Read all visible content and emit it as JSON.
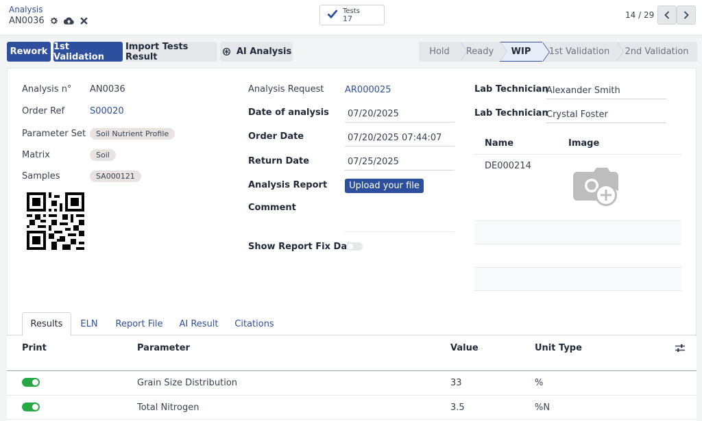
{
  "breadcrumb": {
    "parent": "Analysis",
    "record": "AN0036"
  },
  "smart_button": {
    "label": "Tests",
    "value": "17"
  },
  "pager": {
    "value": "14 / 29"
  },
  "actions": {
    "rework": "Rework",
    "validation": "1st Validation",
    "import": "Import Tests Result",
    "ai": "AI Analysis"
  },
  "statusbar": {
    "stages": [
      "Hold",
      "Ready",
      "WIP",
      "1st Validation",
      "2nd Validation"
    ],
    "active": "WIP"
  },
  "form": {
    "analysis_no": {
      "label": "Analysis n°",
      "value": "AN0036"
    },
    "order_ref": {
      "label": "Order Ref",
      "value": "S00020"
    },
    "parameter_set": {
      "label": "Parameter Set",
      "value": "Soil Nutrient Profile"
    },
    "matrix": {
      "label": "Matrix",
      "value": "Soil"
    },
    "samples": {
      "label": "Samples",
      "value": "SA000121"
    },
    "analysis_request": {
      "label": "Analysis Request",
      "value": "AR000025"
    },
    "date_of_analysis": {
      "label": "Date of analysis",
      "value": "07/20/2025"
    },
    "order_date": {
      "label": "Order Date",
      "value": "07/20/2025 07:44:07"
    },
    "return_date": {
      "label": "Return Date",
      "value": "07/25/2025"
    },
    "analysis_report": {
      "label": "Analysis Report",
      "button": "Upload your file"
    },
    "comment": {
      "label": "Comment",
      "value": ""
    },
    "show_report_fix": {
      "label": "Show Report Fix Data",
      "value": false
    },
    "lab_tech_1": {
      "label": "Lab Technician",
      "value": "Alexander Smith"
    },
    "lab_tech_2": {
      "label": "Lab Technician",
      "value": "Crystal Foster"
    }
  },
  "equipment_table": {
    "headers": [
      "Name",
      "Image"
    ],
    "rows": [
      {
        "name": "DE000214",
        "image": "camera-add-icon"
      }
    ]
  },
  "tabs": [
    "Results",
    "ELN",
    "Report File",
    "AI Result",
    "Citations"
  ],
  "active_tab": "Results",
  "results_table": {
    "headers": [
      "Print",
      "Parameter",
      "Value",
      "Unit Type"
    ],
    "rows": [
      {
        "print": true,
        "parameter": "Grain Size Distribution",
        "value": "33",
        "unit": "%"
      },
      {
        "print": true,
        "parameter": "Total Nitrogen",
        "value": "3.5",
        "unit": "%N"
      }
    ]
  },
  "colors": {
    "primary": "#2d4f9e",
    "toggle_on": "#28a745",
    "tag_bg": "#e8e3e1"
  }
}
